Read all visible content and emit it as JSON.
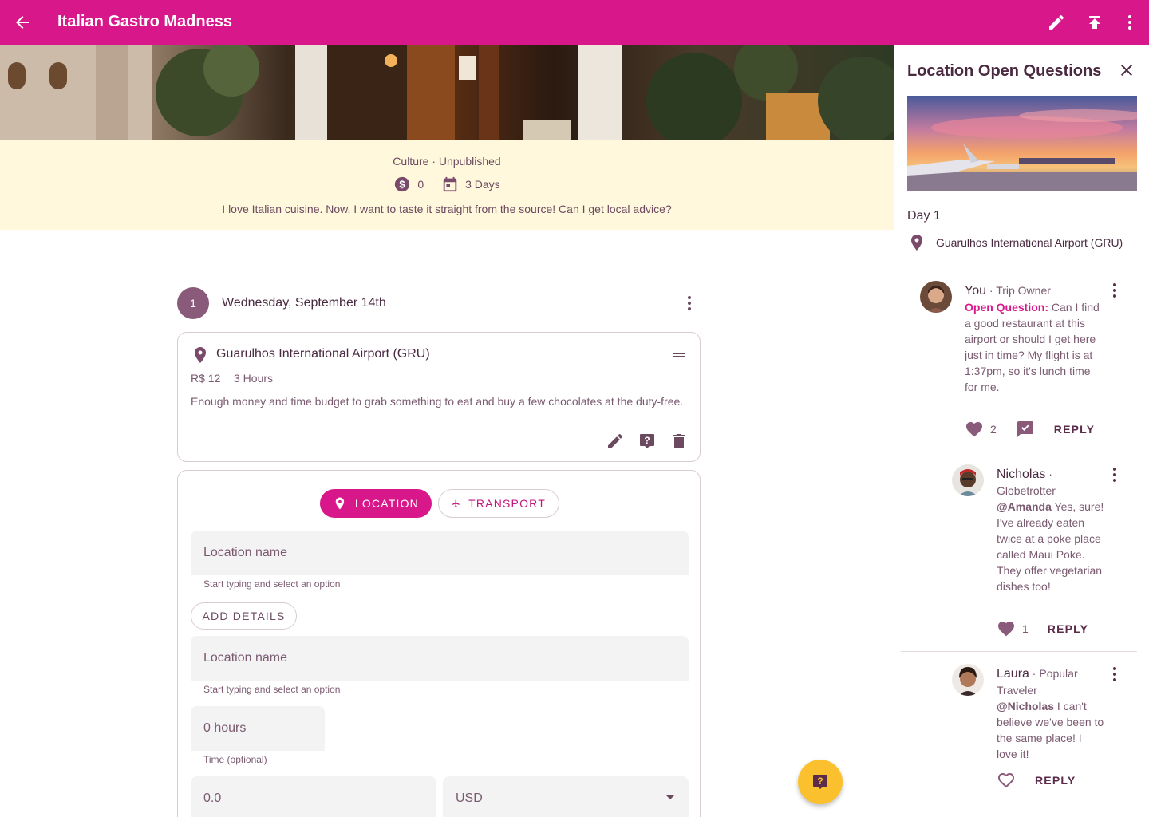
{
  "appbar": {
    "title": "Italian Gastro Madness",
    "back_icon": "arrow-left-icon",
    "actions": [
      "pencil-icon",
      "upload-icon",
      "more-vert-icon"
    ],
    "color": "#d8178a"
  },
  "trip": {
    "meta": "Culture · Unpublished",
    "budget": "0",
    "duration": "3 Days",
    "description": "I love Italian cuisine. Now, I want to taste it straight from the source! Can I get local advice?"
  },
  "day": {
    "number": "1",
    "date": "Wednesday, September 14th"
  },
  "location_card": {
    "name": "Guarulhos International Airport (GRU)",
    "cost": "R$ 12",
    "duration": "3 Hours",
    "note": "Enough money and time budget to grab something to eat and buy a few chocolates at the duty-free."
  },
  "form": {
    "tab_location": "LOCATION",
    "tab_transport": "TRANSPORT",
    "location_name_placeholder": "Location name",
    "location_hint": "Start typing and select an option",
    "add_details": "ADD DETAILS",
    "location_name_placeholder_2": "Location name",
    "location_hint_2": "Start typing and select an option",
    "time_value": "0 hours",
    "time_hint": "Time (optional)",
    "cost_value": "0.0",
    "currency_value": "USD"
  },
  "panel": {
    "title": "Location Open Questions",
    "day": "Day 1",
    "location": "Guarulhos International Airport (GRU)",
    "comments": [
      {
        "name": "You",
        "role": " · Trip Owner",
        "tag": "Open Question:",
        "text": " Can I find a good restaurant at this airport or should I get here just in time? My flight is at 1:37pm, so it's lunch time for me.",
        "likes": "2",
        "reply": "REPLY"
      },
      {
        "name": "Nicholas",
        "role": " · Globetrotter",
        "tag": "@Amanda",
        "text": " Yes, sure! I've already eaten twice at a poke place called Maui Poke. They offer vegetarian dishes too!",
        "likes": "1",
        "reply": "REPLY"
      },
      {
        "name": "Laura",
        "role": " · Popular Traveler",
        "tag": "@Nicholas",
        "text": " I can't believe we've been to the same place! I love it!",
        "reply": "REPLY"
      }
    ]
  }
}
